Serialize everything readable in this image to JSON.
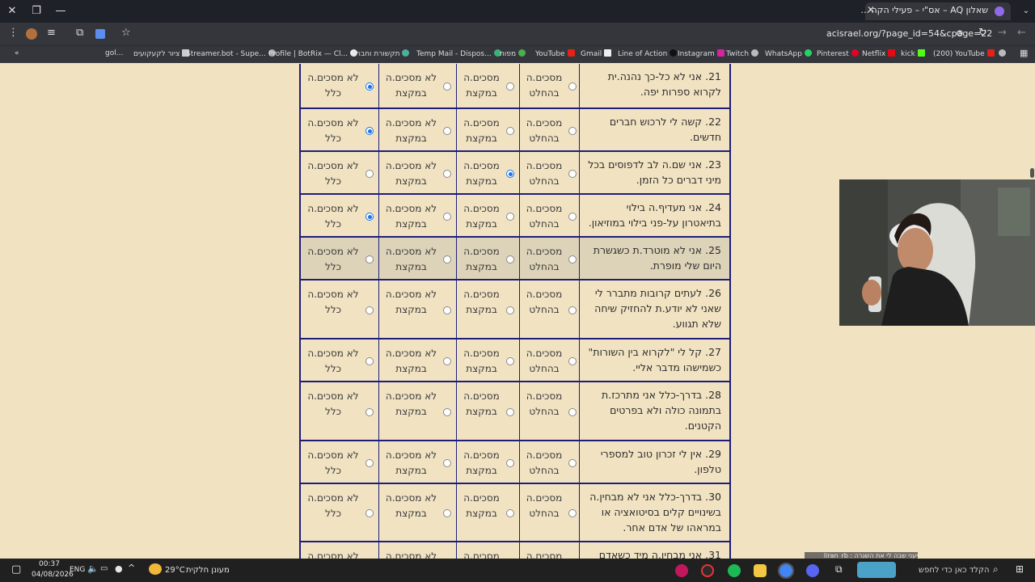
{
  "browser": {
    "tab_title": "שאלון AQ – אס\"י – פעילי הקהי...",
    "url": "acisrael.org/?page_id=54&cpage=22",
    "bookmarks": [
      "gol...",
      "ציור לקעקועים",
      "Streamer.bot - Supe...",
      "Profile | BotRix — Cl...",
      "תקשורת וחברה",
      "Temp Mail - Dispos...",
      "מפות",
      "YouTube",
      "Gmail",
      "Line of Action",
      "Instagram",
      "Twitch",
      "WhatsApp",
      "Pinterest",
      "Netflix",
      "kick",
      "(200) YouTube"
    ]
  },
  "survey": {
    "options": [
      "מסכים.ה בהחלט",
      "מסכים.ה במקצת",
      "לא מסכים.ה במקצת",
      "לא מסכים.ה כלל"
    ],
    "questions": [
      {
        "text": "21. אני לא כל-כך נהנה.ית לקרוא ספרות יפה.",
        "selected": 3
      },
      {
        "text": "22. קשה לי לרכוש חברים חדשים.",
        "selected": 3
      },
      {
        "text": "23. אני שם.ה לב לדפוסים בכל מיני דברים כל הזמן.",
        "selected": 1
      },
      {
        "text": "24. אני מעדיף.ה בילוי בתיאטרון על-פני בילוי במוזיאון.",
        "selected": 3
      },
      {
        "text": "25. אני לא מוטרד.ת כשגשרת היום שלי מופרת.",
        "selected": -1
      },
      {
        "text": "26. לעתים קרובות מתברר לי שאני לא יודע.ת להחזיק שיחה שלא תגווע.",
        "selected": -1
      },
      {
        "text": "27. קל לי \"לקרוא בין השורות\" כשמישהו מדבר אליי.",
        "selected": -1
      },
      {
        "text": "28. בדרך-כלל אני מתרכז.ת בתמונה כולה ולא בפרטים הקטנים.",
        "selected": -1
      },
      {
        "text": "29. אין לי זכרון טוב למספרי טלפון.",
        "selected": -1
      },
      {
        "text": "30. בדרך-כלל אני לא מבחין.ה בשינויים קלים בסיטואציה או במראהו של אדם אחר.",
        "selected": -1
      },
      {
        "text": "31. אני מבחין.ה מיד כשאדם",
        "selected": -1
      }
    ]
  },
  "chat_overlay": "יעני שבה לי את השגרה : liran_rb",
  "taskbar": {
    "search_placeholder": "הקלד כאן כדי לחפש",
    "weather_text": "מעונן חלקית",
    "temperature": "29°C",
    "language": "ENG",
    "time": "00:37",
    "date": "04/08/2026"
  },
  "colors": {
    "accent": "#1a73e8",
    "grid": "#1e1e7a",
    "page_bg": "#f1e3c2",
    "highlight_row": "#ddd3b8"
  }
}
